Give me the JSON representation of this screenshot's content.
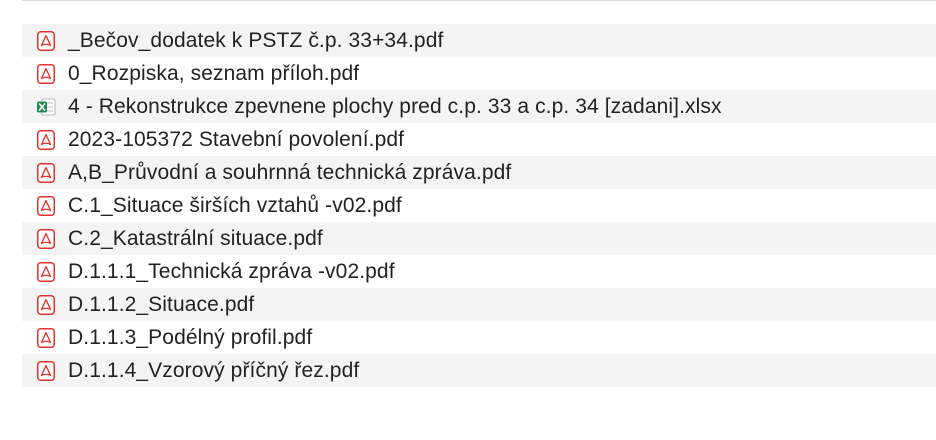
{
  "colors": {
    "pdf_red": "#e5312b",
    "xlsx_green": "#1f8a4c",
    "row_alt": "#f4f4f5",
    "text": "#222222"
  },
  "files": [
    {
      "name": "_Bečov_dodatek k PSTZ č.p. 33+34.pdf",
      "icon": "pdf-icon"
    },
    {
      "name": "0_Rozpiska, seznam příloh.pdf",
      "icon": "pdf-icon"
    },
    {
      "name": "4 - Rekonstrukce zpevnene plochy pred c.p. 33 a c.p. 34 [zadani].xlsx",
      "icon": "xlsx-icon"
    },
    {
      "name": "2023-105372 Stavební povolení.pdf",
      "icon": "pdf-icon"
    },
    {
      "name": "A,B_Průvodní a souhrnná technická zpráva.pdf",
      "icon": "pdf-icon"
    },
    {
      "name": "C.1_Situace širších vztahů -v02.pdf",
      "icon": "pdf-icon"
    },
    {
      "name": "C.2_Katastrální situace.pdf",
      "icon": "pdf-icon"
    },
    {
      "name": "D.1.1.1_Technická zpráva -v02.pdf",
      "icon": "pdf-icon"
    },
    {
      "name": "D.1.1.2_Situace.pdf",
      "icon": "pdf-icon"
    },
    {
      "name": "D.1.1.3_Podélný profil.pdf",
      "icon": "pdf-icon"
    },
    {
      "name": "D.1.1.4_Vzorový příčný řez.pdf",
      "icon": "pdf-icon"
    }
  ]
}
